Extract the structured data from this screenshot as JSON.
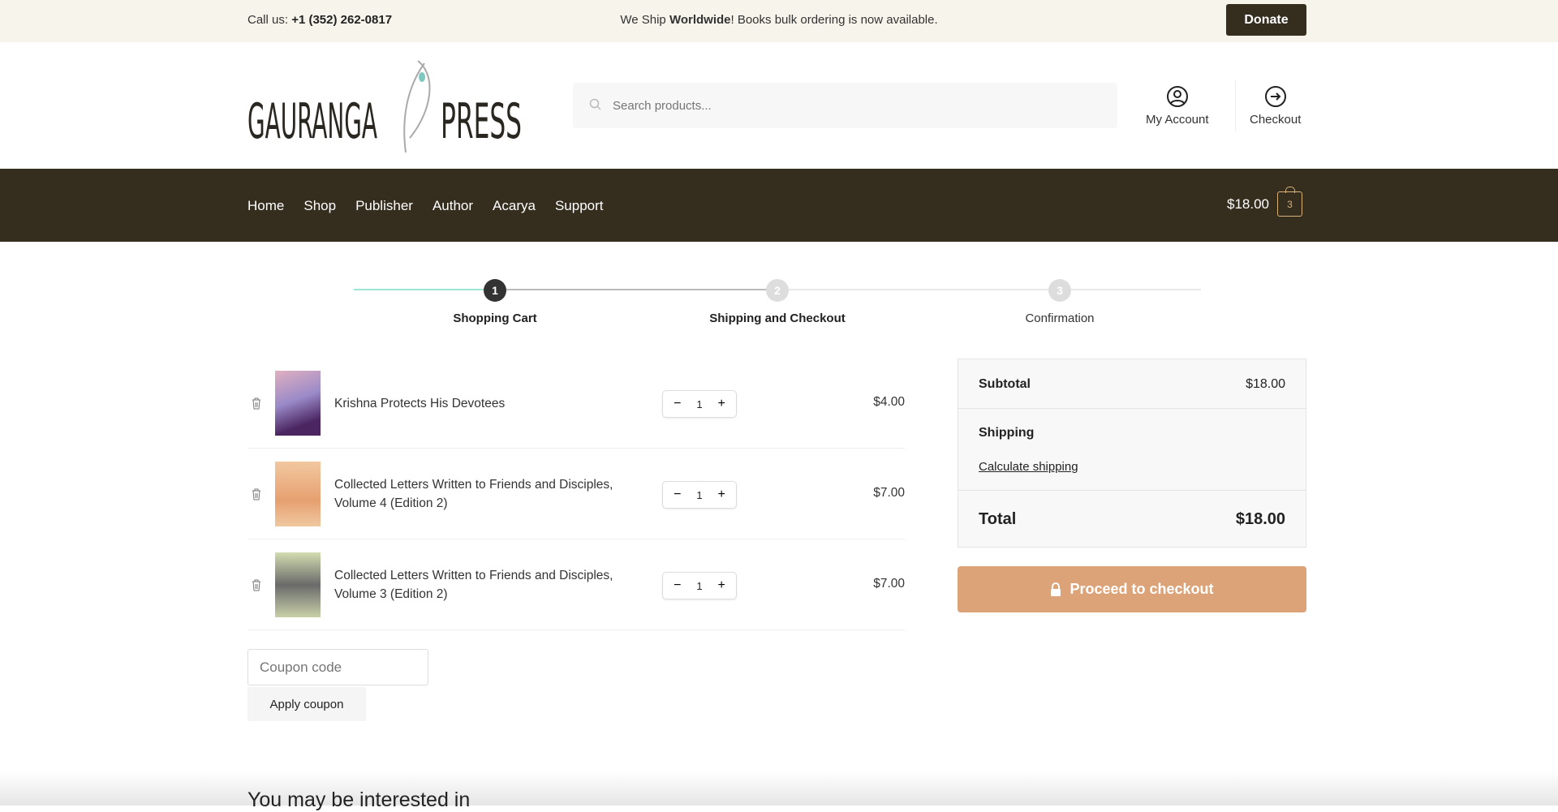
{
  "topbar": {
    "call_label": "Call us:",
    "phone": "+1 (352) 262-0817",
    "msg_pre": "We Ship ",
    "msg_bold": "Worldwide",
    "msg_post": "! Books bulk ordering is now available.",
    "donate": "Donate"
  },
  "header": {
    "logo_text": "Gauranga Press",
    "search_placeholder": "Search products...",
    "account": "My Account",
    "checkout": "Checkout"
  },
  "nav": {
    "items": [
      "Home",
      "Shop",
      "Publisher",
      "Author",
      "Acarya",
      "Support"
    ],
    "cart_total": "$18.00",
    "cart_count": "3"
  },
  "steps": [
    {
      "num": "1",
      "label": "Shopping Cart"
    },
    {
      "num": "2",
      "label": "Shipping and Checkout"
    },
    {
      "num": "3",
      "label": "Confirmation"
    }
  ],
  "cart": [
    {
      "name": "Krishna Protects His Devotees",
      "qty": "1",
      "price": "$4.00"
    },
    {
      "name": "Collected Letters Written to Friends and Disciples, Volume 4 (Edition 2)",
      "qty": "1",
      "price": "$7.00"
    },
    {
      "name": "Collected Letters Written to Friends and Disciples, Volume 3 (Edition 2)",
      "qty": "1",
      "price": "$7.00"
    }
  ],
  "summary": {
    "subtotal_label": "Subtotal",
    "subtotal": "$18.00",
    "shipping_label": "Shipping",
    "calc_shipping": "Calculate shipping",
    "total_label": "Total",
    "total": "$18.00",
    "checkout_btn": "Proceed to checkout"
  },
  "coupon": {
    "placeholder": "Coupon code",
    "apply": "Apply coupon"
  },
  "interested": "You may be interested in",
  "colors": {
    "brand_dark": "#352d1e",
    "accent": "#dda378",
    "step_done": "#7fe0c8"
  }
}
